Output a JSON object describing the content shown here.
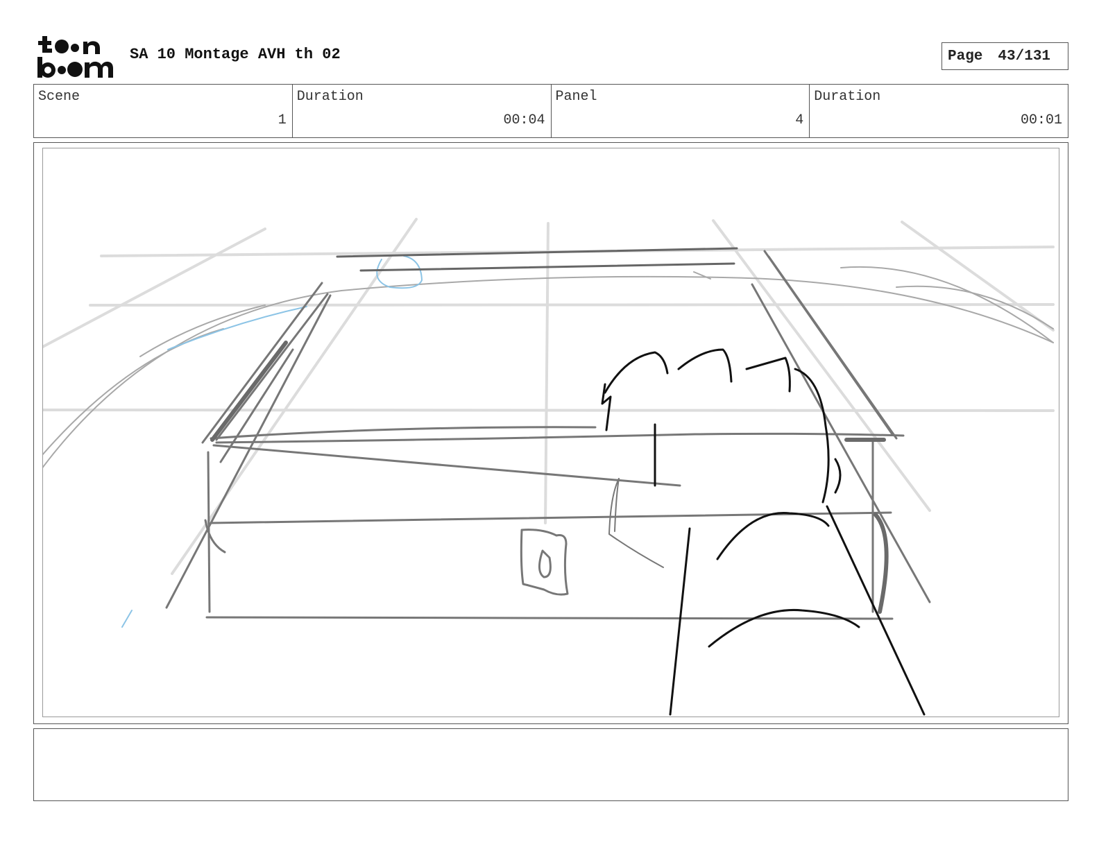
{
  "header": {
    "logo_text": "toon boom",
    "title": "SA 10 Montage AVH th 02",
    "page_label": "Page",
    "page_value": "43/131"
  },
  "info": {
    "scene_label": "Scene",
    "scene_value": "1",
    "scene_duration_label": "Duration",
    "scene_duration_value": "00:04",
    "panel_label": "Panel",
    "panel_value": "4",
    "panel_duration_label": "Duration",
    "panel_duration_value": "00:01"
  },
  "notes": {
    "text": ""
  }
}
